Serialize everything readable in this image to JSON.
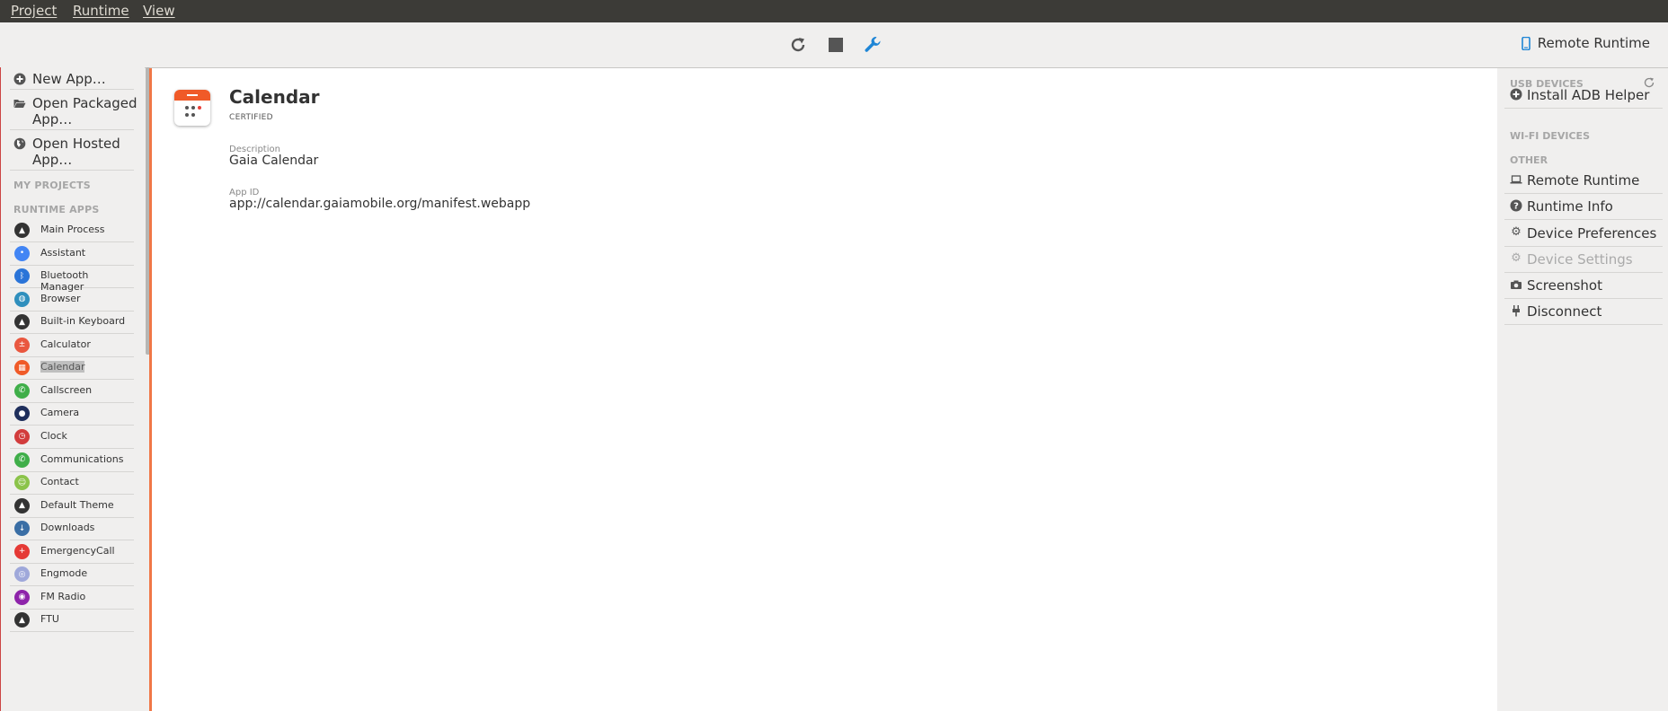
{
  "menubar": {
    "items": [
      "Project",
      "Runtime",
      "View"
    ]
  },
  "toolbar": {
    "runtime_label": "Remote Runtime"
  },
  "project_actions": [
    {
      "label": "New App…"
    },
    {
      "label": "Open Packaged App…"
    },
    {
      "label": "Open Hosted App…"
    }
  ],
  "sections": {
    "my_projects": "MY PROJECTS",
    "runtime_apps": "RUNTIME APPS"
  },
  "runtime_apps": [
    {
      "label": "Main Process",
      "icon": "firefox-os-icon",
      "color": "#333333"
    },
    {
      "label": "Assistant",
      "icon": "assistant-icon",
      "color": "#4285f4"
    },
    {
      "label": "Bluetooth Manager",
      "icon": "bluetooth-icon",
      "color": "#2a74d8"
    },
    {
      "label": "Browser",
      "icon": "globe-icon",
      "color": "#2f8fbd"
    },
    {
      "label": "Built-in Keyboard",
      "icon": "firefox-os-icon",
      "color": "#333333"
    },
    {
      "label": "Calculator",
      "icon": "calculator-icon",
      "color": "#e9573f"
    },
    {
      "label": "Calendar",
      "icon": "calendar-icon",
      "color": "#f05a28"
    },
    {
      "label": "Callscreen",
      "icon": "phone-icon",
      "color": "#3fae49"
    },
    {
      "label": "Camera",
      "icon": "camera-icon",
      "color": "#1f2f5c"
    },
    {
      "label": "Clock",
      "icon": "clock-icon",
      "color": "#d23c3c"
    },
    {
      "label": "Communications",
      "icon": "phone-icon",
      "color": "#3fae49"
    },
    {
      "label": "Contact",
      "icon": "contact-icon",
      "color": "#8bc34a"
    },
    {
      "label": "Default Theme",
      "icon": "firefox-os-icon",
      "color": "#333333"
    },
    {
      "label": "Downloads",
      "icon": "download-icon",
      "color": "#3a6ea5"
    },
    {
      "label": "EmergencyCall",
      "icon": "emergency-icon",
      "color": "#e53935"
    },
    {
      "label": "Engmode",
      "icon": "engmode-icon",
      "color": "#9fa8da"
    },
    {
      "label": "FM Radio",
      "icon": "radio-icon",
      "color": "#8e24aa"
    },
    {
      "label": "FTU",
      "icon": "firefox-os-icon",
      "color": "#333333"
    }
  ],
  "selected_app": "Calendar",
  "main": {
    "title": "Calendar",
    "type": "CERTIFIED",
    "description_label": "Description",
    "description": "Gaia Calendar",
    "appid_label": "App ID",
    "appid": "app://calendar.gaiamobile.org/manifest.webapp"
  },
  "right": {
    "usb_devices": "USB DEVICES",
    "wifi_devices": "WI-FI DEVICES",
    "other": "OTHER",
    "install_adb": "Install ADB Helper",
    "remote_runtime": "Remote Runtime",
    "runtime_info": "Runtime Info",
    "device_preferences": "Device Preferences",
    "device_settings": "Device Settings",
    "screenshot": "Screenshot",
    "disconnect": "Disconnect"
  },
  "colors": {
    "accent": "#f07746",
    "link": "#1f86d6",
    "menubar": "#3c3b37"
  }
}
